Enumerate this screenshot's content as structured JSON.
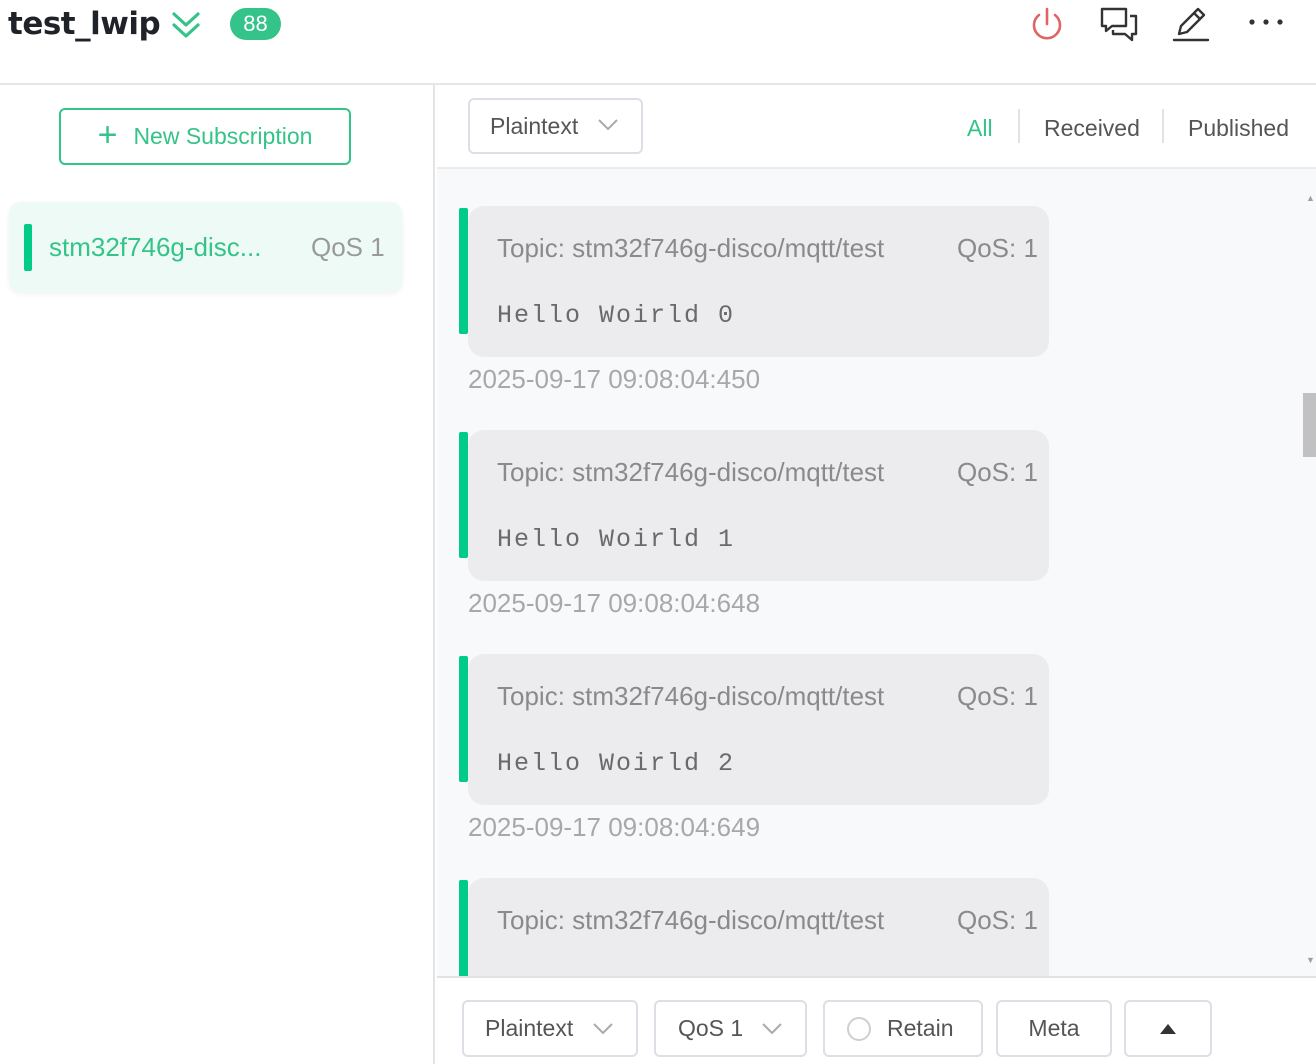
{
  "header": {
    "connection_name": "test_lwip",
    "message_count": "88"
  },
  "left_panel": {
    "new_subscription_label": "New Subscription",
    "subscriptions": [
      {
        "topic": "stm32f746g-disc...",
        "qos": "QoS 1",
        "color": "#00cc88"
      }
    ]
  },
  "toolbar": {
    "format": "Plaintext",
    "filters": {
      "all": "All",
      "received": "Received",
      "published": "Published"
    },
    "active_filter": "All"
  },
  "messages": [
    {
      "topic": "Topic: stm32f746g-disco/mqtt/test",
      "qos": "QoS: 1",
      "payload": "Hello Woirld 0",
      "time": "2025-09-17 09:08:04:450"
    },
    {
      "topic": "Topic: stm32f746g-disco/mqtt/test",
      "qos": "QoS: 1",
      "payload": "Hello Woirld 1",
      "time": "2025-09-17 09:08:04:648"
    },
    {
      "topic": "Topic: stm32f746g-disco/mqtt/test",
      "qos": "QoS: 1",
      "payload": "Hello Woirld 2",
      "time": "2025-09-17 09:08:04:649"
    },
    {
      "topic": "Topic: stm32f746g-disco/mqtt/test",
      "qos": "QoS: 1"
    }
  ],
  "publish_bar": {
    "format": "Plaintext",
    "qos": "QoS 1",
    "retain_label": "Retain",
    "meta_label": "Meta"
  },
  "colors": {
    "accent": "#34c388",
    "topic_bar": "#00cc88",
    "disconnect": "#e06464"
  }
}
